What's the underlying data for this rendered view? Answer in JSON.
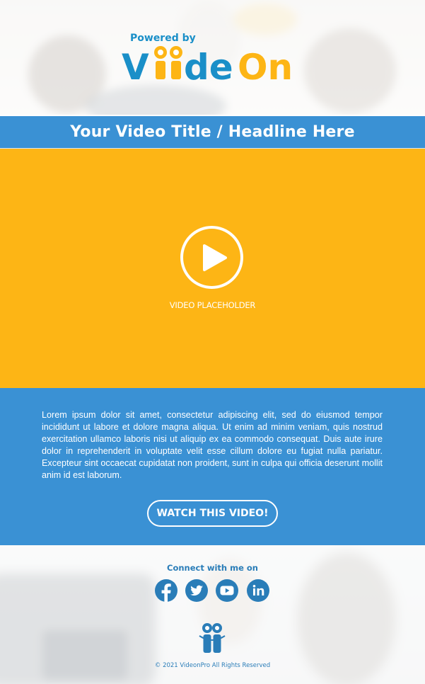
{
  "header": {
    "powered_by": "Powered by",
    "brand_name": "ViideOn"
  },
  "title_bar": {
    "headline": "Your Video Title / Headline Here"
  },
  "video": {
    "placeholder_label": "VIDEO PLACEHOLDER"
  },
  "content": {
    "body_text": "Lorem ipsum dolor sit amet, consectetur adipiscing elit, sed do eiusmod tempor incididunt ut labore et dolore magna aliqua. Ut enim ad minim veniam, quis nostrud exercitation ullamco laboris nisi ut aliquip ex ea commodo consequat. Duis aute irure dolor in reprehenderit in voluptate velit esse cillum dolore eu fugiat nulla pariatur. Excepteur sint occaecat cupidatat non proident, sunt in culpa qui officia deserunt mollit anim id est laborum.",
    "cta_label": "WATCH THIS VIDEO!"
  },
  "footer": {
    "connect_label": "Connect with me on",
    "social": [
      {
        "icon": "facebook-icon"
      },
      {
        "icon": "twitter-icon"
      },
      {
        "icon": "youtube-icon"
      },
      {
        "icon": "linkedin-icon"
      }
    ],
    "copyright": "© 2021 VideonPro All Rights Reserved"
  },
  "colors": {
    "brand_blue": "#3a91d4",
    "brand_orange": "#fdb515",
    "logo_teal": "#1a8fc8",
    "white": "#ffffff"
  }
}
